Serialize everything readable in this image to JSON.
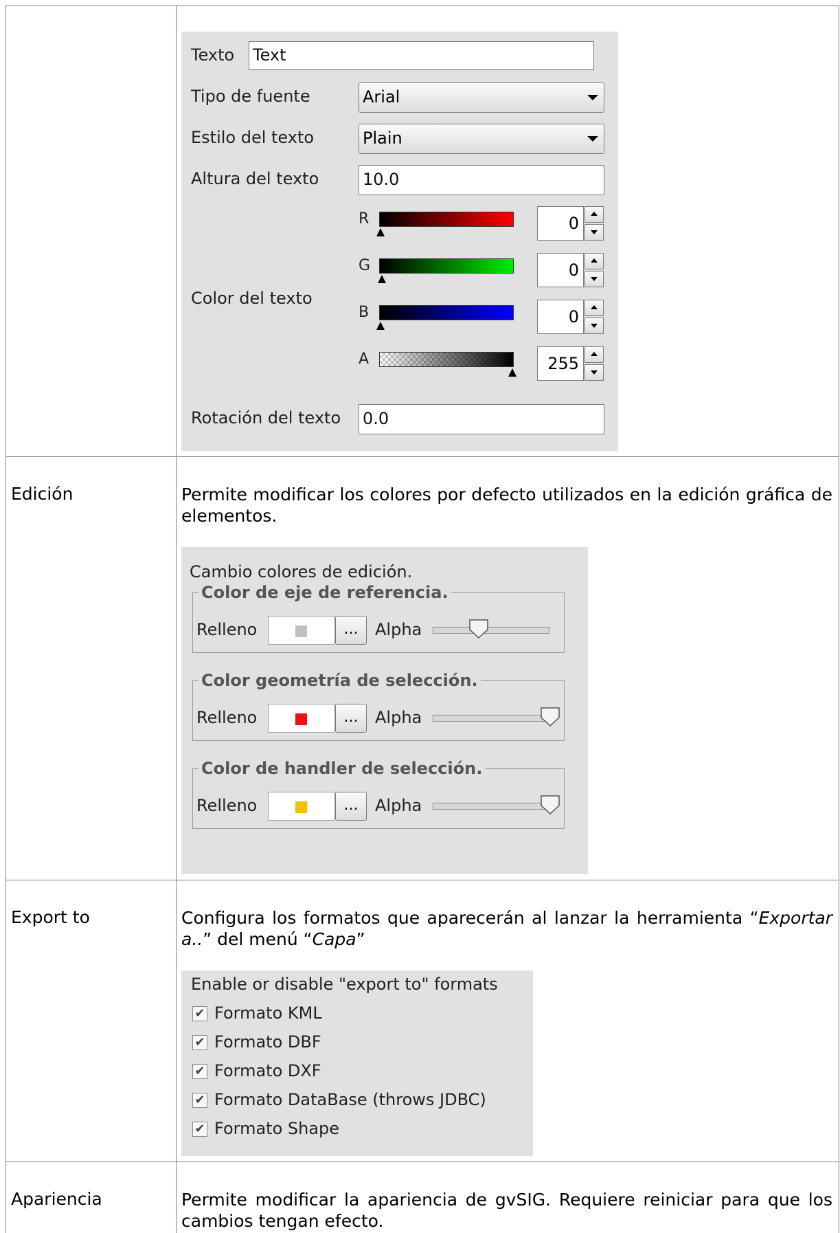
{
  "text_panel": {
    "texto_label": "Texto",
    "texto_value": "Text",
    "tipo_fuente_label": "Tipo de fuente",
    "tipo_fuente_value": "Arial",
    "estilo_label": "Estilo del texto",
    "estilo_value": "Plain",
    "altura_label": "Altura del texto",
    "altura_value": "10.0",
    "color_label": "Color del texto",
    "channels": [
      {
        "label": "R",
        "value": "0",
        "level": 0,
        "end_color": "#ff0000"
      },
      {
        "label": "G",
        "value": "0",
        "level": 0,
        "end_color": "#00ff00"
      },
      {
        "label": "B",
        "value": "0",
        "level": 0,
        "end_color": "#0000ff"
      },
      {
        "label": "A",
        "value": "255",
        "level": 1,
        "end_color": "#000000"
      }
    ],
    "rotacion_label": "Rotación del texto",
    "rotacion_value": "0.0"
  },
  "rows": {
    "edicion": {
      "label": "Edición",
      "description": "Permite modificar los colores por defecto utilizados en la edición gráfica de elementos."
    },
    "export_to": {
      "label": "Export to",
      "description_part1": "Configura los formatos que aparecerán al lanzar la herramienta “",
      "description_em1": "Exportar a..",
      "description_part2": "” del menú “",
      "description_em2": "Capa",
      "description_part3": "”"
    },
    "apariencia": {
      "label": "Apariencia",
      "description": "Permite modificar la apariencia de gvSIG. Requiere reiniciar para que los cambios tengan efecto."
    }
  },
  "edit_panel": {
    "title": "Cambio colores de edición.",
    "groups": [
      {
        "legend": "Color de eje de referencia.",
        "fill_label": "Relleno",
        "color": "#c0c0c0",
        "button": "...",
        "alpha_label": "Alpha",
        "alpha_level": 0.4
      },
      {
        "legend": "Color geometría de selección.",
        "fill_label": "Relleno",
        "color": "#ee1111",
        "button": "...",
        "alpha_label": "Alpha",
        "alpha_level": 1
      },
      {
        "legend": "Color de handler de selección.",
        "fill_label": "Relleno",
        "color": "#f5c000",
        "button": "...",
        "alpha_label": "Alpha",
        "alpha_level": 1
      }
    ]
  },
  "export_panel": {
    "title": "Enable or disable \"export to\" formats",
    "check_mark": "✔",
    "formats": [
      {
        "label": "Formato KML",
        "checked": true
      },
      {
        "label": "Formato DBF",
        "checked": true
      },
      {
        "label": "Formato DXF",
        "checked": true
      },
      {
        "label": "Formato DataBase (throws JDBC)",
        "checked": true
      },
      {
        "label": "Formato Shape",
        "checked": true
      }
    ]
  }
}
